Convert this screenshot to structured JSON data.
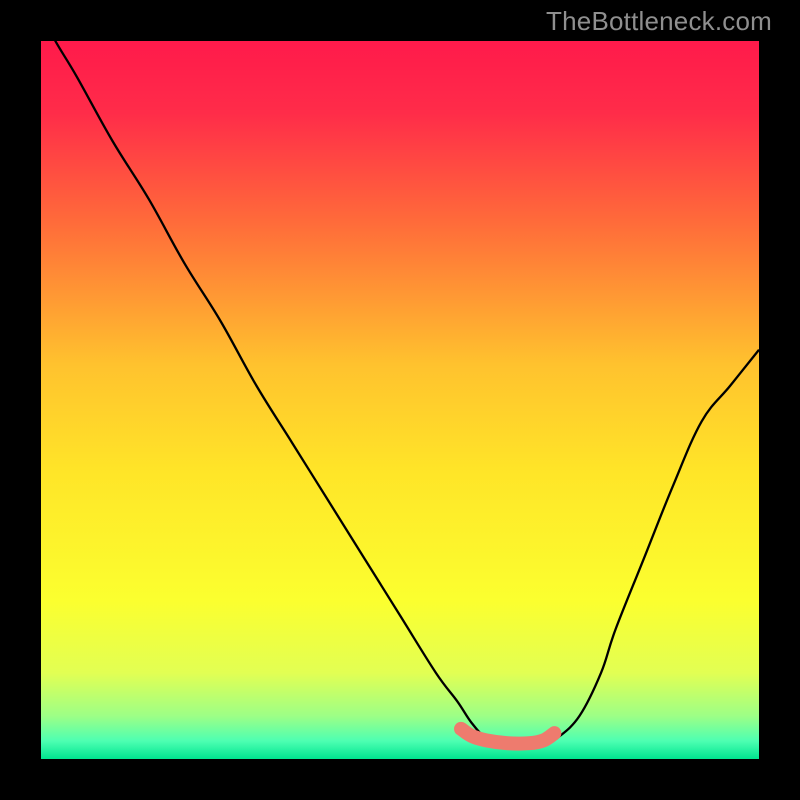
{
  "watermark": "TheBottleneck.com",
  "chart_data": {
    "type": "line",
    "title": "",
    "xlabel": "",
    "ylabel": "",
    "ylim": [
      0,
      100
    ],
    "xlim": [
      0,
      100
    ],
    "gradient_stops": [
      {
        "offset": 0.0,
        "color": "#ff1a4b"
      },
      {
        "offset": 0.1,
        "color": "#ff2c49"
      },
      {
        "offset": 0.25,
        "color": "#ff6a3a"
      },
      {
        "offset": 0.45,
        "color": "#ffc22e"
      },
      {
        "offset": 0.6,
        "color": "#ffe528"
      },
      {
        "offset": 0.78,
        "color": "#fbff2f"
      },
      {
        "offset": 0.88,
        "color": "#e2ff53"
      },
      {
        "offset": 0.94,
        "color": "#9dff86"
      },
      {
        "offset": 0.975,
        "color": "#4dffb2"
      },
      {
        "offset": 1.0,
        "color": "#00e58f"
      }
    ],
    "series": [
      {
        "name": "bottleneck-curve",
        "x": [
          0,
          2,
          5,
          10,
          15,
          20,
          25,
          30,
          35,
          40,
          45,
          50,
          55,
          58,
          60,
          62,
          65,
          68,
          70,
          72,
          75,
          78,
          80,
          84,
          88,
          92,
          96,
          100
        ],
        "y": [
          104,
          100,
          95,
          86,
          78,
          69,
          61,
          52,
          44,
          36,
          28,
          20,
          12,
          8,
          5,
          3,
          2,
          2,
          2,
          3,
          6,
          12,
          18,
          28,
          38,
          47,
          52,
          57
        ]
      },
      {
        "name": "optimal-band",
        "x": [
          58.5,
          60,
          62,
          65,
          68,
          70,
          71.5
        ],
        "y": [
          4.2,
          3.2,
          2.6,
          2.2,
          2.2,
          2.6,
          3.6
        ]
      }
    ],
    "marker": {
      "x": 58.5,
      "y": 4.2,
      "color": "#ee7b6e",
      "r": 6
    },
    "band_style": {
      "color": "#ee7b6e",
      "width": 14
    },
    "curve_style": {
      "color": "#000000",
      "width": 2.3
    }
  }
}
